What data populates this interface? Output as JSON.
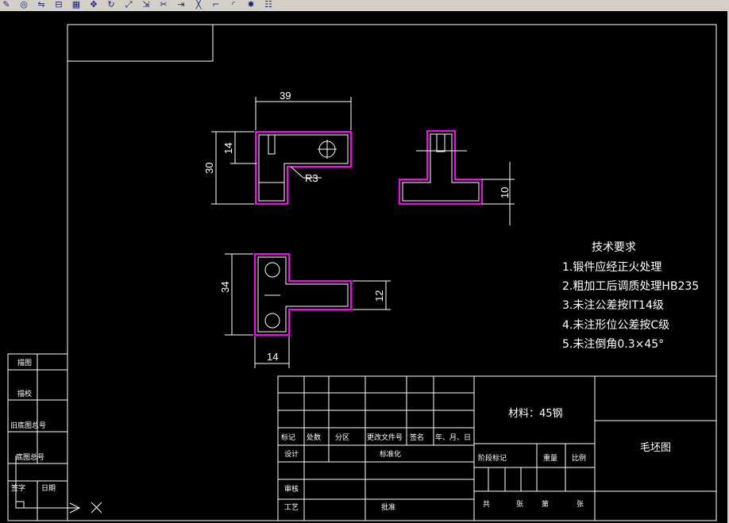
{
  "toolbar": {
    "icons": [
      "pencil-icon",
      "circle-tool-icon",
      "mirror-icon",
      "offset-icon",
      "array-icon",
      "move-icon",
      "rotate-icon",
      "scale-icon",
      "stretch-icon",
      "trim-icon",
      "extend-icon",
      "break-icon",
      "chamfer-icon",
      "fillet-icon",
      "explode-icon",
      "properties-icon"
    ]
  },
  "colors": {
    "line": "#ffffff",
    "outline": "#ff00ff",
    "background": "#000000"
  },
  "views": {
    "top": {
      "dim_width": "39",
      "dim_height": "30",
      "dim_inner": "14",
      "dim_radius": "R3"
    },
    "side": {
      "dim_height": "10"
    },
    "front": {
      "dim_height": "34",
      "dim_thickness": "12",
      "dim_width": "14"
    }
  },
  "notes": {
    "title": "技术要求",
    "items": [
      "1.锻件应经正火处理",
      "2.粗加工后调质处理HB235",
      "3.未注公差按IT14级",
      "4.未注形位公差按C级",
      "5.未注倒角0.3×45°"
    ]
  },
  "left_panel": {
    "labels": [
      "描图",
      "描校",
      "旧底图总号",
      "底图总号",
      "签字",
      "日期"
    ]
  },
  "title_block": {
    "material": "材料：45钢",
    "drawing_name": "毛坯图",
    "headers": [
      "标记",
      "处数",
      "分区",
      "更改文件号",
      "签名",
      "年、月、日"
    ],
    "design": "设计",
    "standardize": "标准化",
    "stage_mark": "阶段标记",
    "weight": "重量",
    "scale": "比例",
    "review": "审核",
    "process": "工艺",
    "approve": "批准",
    "total": "共",
    "sheet_of": "张",
    "sheet": "第",
    "sheet_of2": "张"
  }
}
